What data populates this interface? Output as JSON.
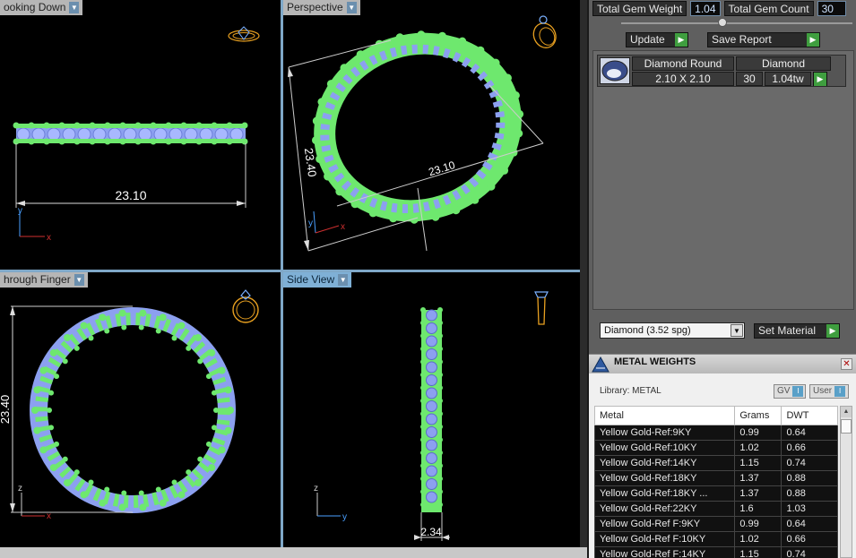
{
  "viewports": {
    "top_left": {
      "label": "ooking Down",
      "dimension": "23.10",
      "axes": {
        "v": "y",
        "h": "x"
      }
    },
    "top_right": {
      "label": "Perspective",
      "dim_vertical": "23.40",
      "dim_diag": "23.10",
      "axes": {
        "v": "y",
        "h": "x"
      }
    },
    "bottom_left": {
      "label": "hrough Finger",
      "dimension": "23.40",
      "axes": {
        "v": "z",
        "h": "x"
      }
    },
    "bottom_right": {
      "label": "Side View",
      "dimension": "2.34",
      "axes": {
        "v": "z",
        "h": "y"
      }
    }
  },
  "icons": {
    "tl": "ring-top-icon",
    "tr": "ring-perspective-icon",
    "bl": "ring-front-icon",
    "br": "ring-side-icon"
  },
  "colors": {
    "prong_green": "#6ee86e",
    "gem_blue": "#8ca0f0",
    "wire_orange": "#e8a020",
    "accent_blue": "#7fb0d6",
    "go_green": "#3f9e3f"
  },
  "panel": {
    "total_gem_weight_label": "Total Gem Weight",
    "total_gem_weight_value": "1.04",
    "total_gem_count_label": "Total Gem Count",
    "total_gem_count_value": "30",
    "update_label": "Update",
    "save_report_label": "Save Report",
    "gem": {
      "type": "Diamond Round",
      "material": "Diamond",
      "size": "2.10 X 2.10",
      "count": "30",
      "weight": "1.04tw"
    },
    "material_select": "Diamond     (3.52 spg)",
    "set_material_label": "Set Material"
  },
  "metal_weights": {
    "title": "METAL WEIGHTS",
    "library_label": "Library: METAL",
    "toggle_gv": "GV",
    "toggle_user": "User",
    "columns": [
      "Metal",
      "Grams",
      "DWT"
    ],
    "rows": [
      [
        "Yellow Gold-Ref:9KY",
        "0.99",
        "0.64"
      ],
      [
        "Yellow Gold-Ref:10KY",
        "1.02",
        "0.66"
      ],
      [
        "Yellow Gold-Ref:14KY",
        "1.15",
        "0.74"
      ],
      [
        "Yellow Gold-Ref:18KY",
        "1.37",
        "0.88"
      ],
      [
        "Yellow Gold-Ref:18KY ...",
        "1.37",
        "0.88"
      ],
      [
        "Yellow Gold-Ref:22KY",
        "1.6",
        "1.03"
      ],
      [
        "Yellow Gold-Ref F:9KY",
        "0.99",
        "0.64"
      ],
      [
        "Yellow Gold-Ref F:10KY",
        "1.02",
        "0.66"
      ],
      [
        "Yellow Gold-Ref F:14KY",
        "1.15",
        "0.74"
      ]
    ]
  }
}
